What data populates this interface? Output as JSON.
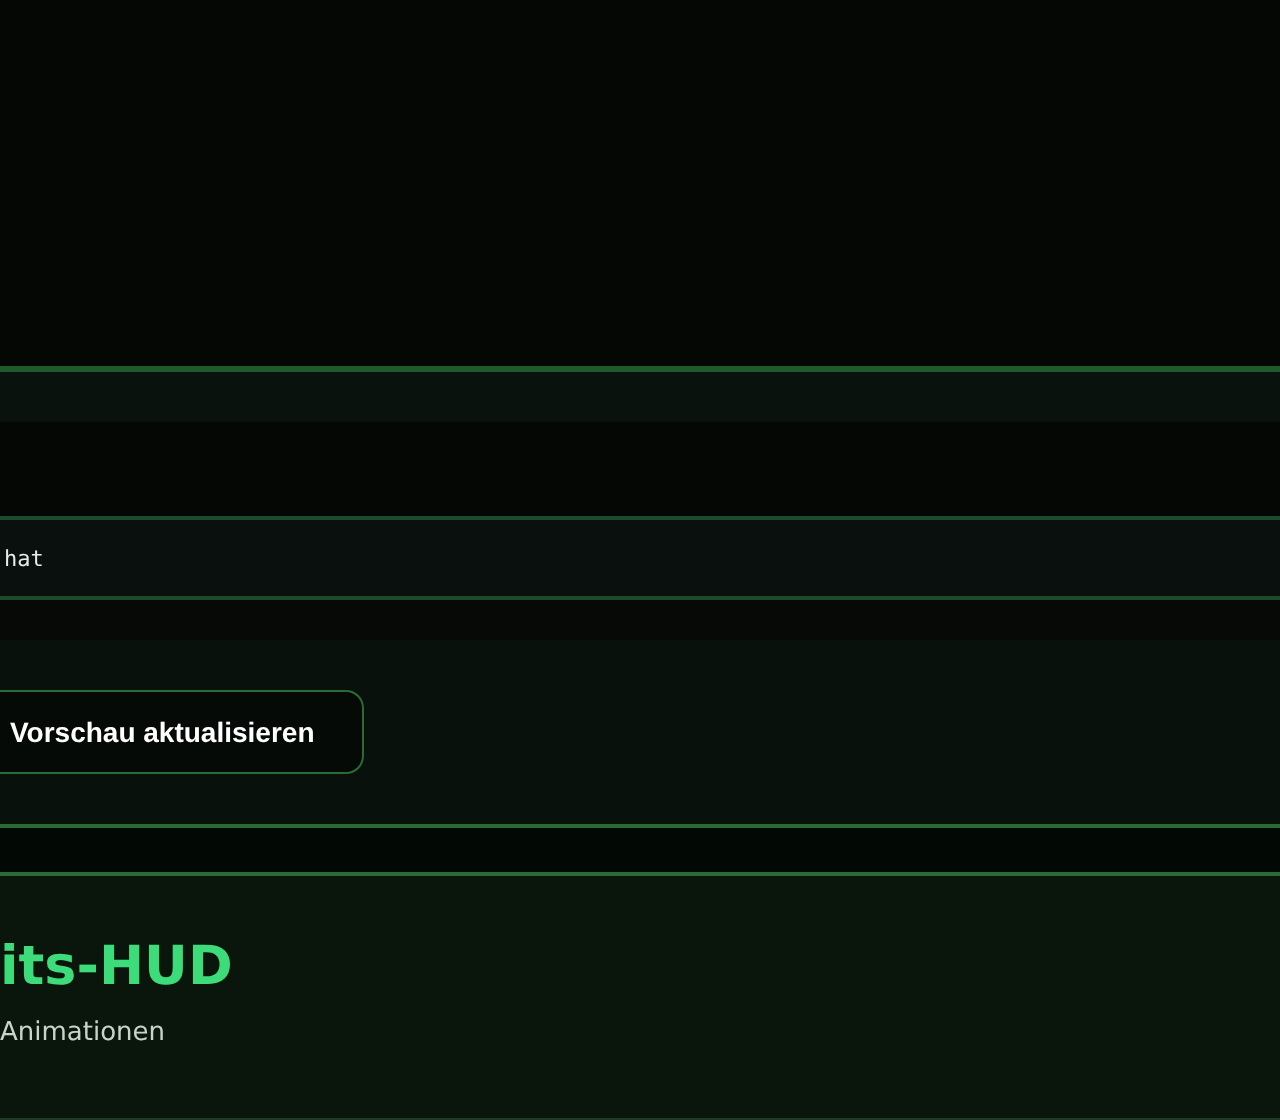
{
  "code_field": {
    "value": "hat"
  },
  "preview_button": {
    "label": "Vorschau aktualisieren"
  },
  "hud_card": {
    "title": "its-HUD",
    "subtitle": "Animationen"
  }
}
